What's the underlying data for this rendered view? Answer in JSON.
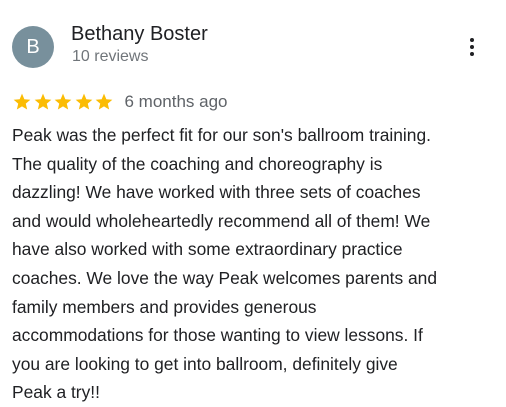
{
  "review": {
    "avatar_letter": "B",
    "avatar_color": "#78909c",
    "reviewer_name": "Bethany Boster",
    "review_count": "10 reviews",
    "rating": 5,
    "star_color": "#fbbc04",
    "date": "6 months ago",
    "text": "Peak was the perfect fit for our son's ballroom training.\nThe quality of the coaching and choreography is\ndazzling!  We have worked with three sets of coaches\nand would wholeheartedly recommend all of them! We\nhave also worked with some  extraordinary practice\ncoaches.  We love the way Peak welcomes parents and\nfamily members and provides generous\naccommodations for those wanting to view lessons.  If\nyou are looking to get into ballroom, definitely give\nPeak a try!!"
  },
  "icons": {
    "more": "more-vert-icon",
    "star": "star-icon"
  }
}
